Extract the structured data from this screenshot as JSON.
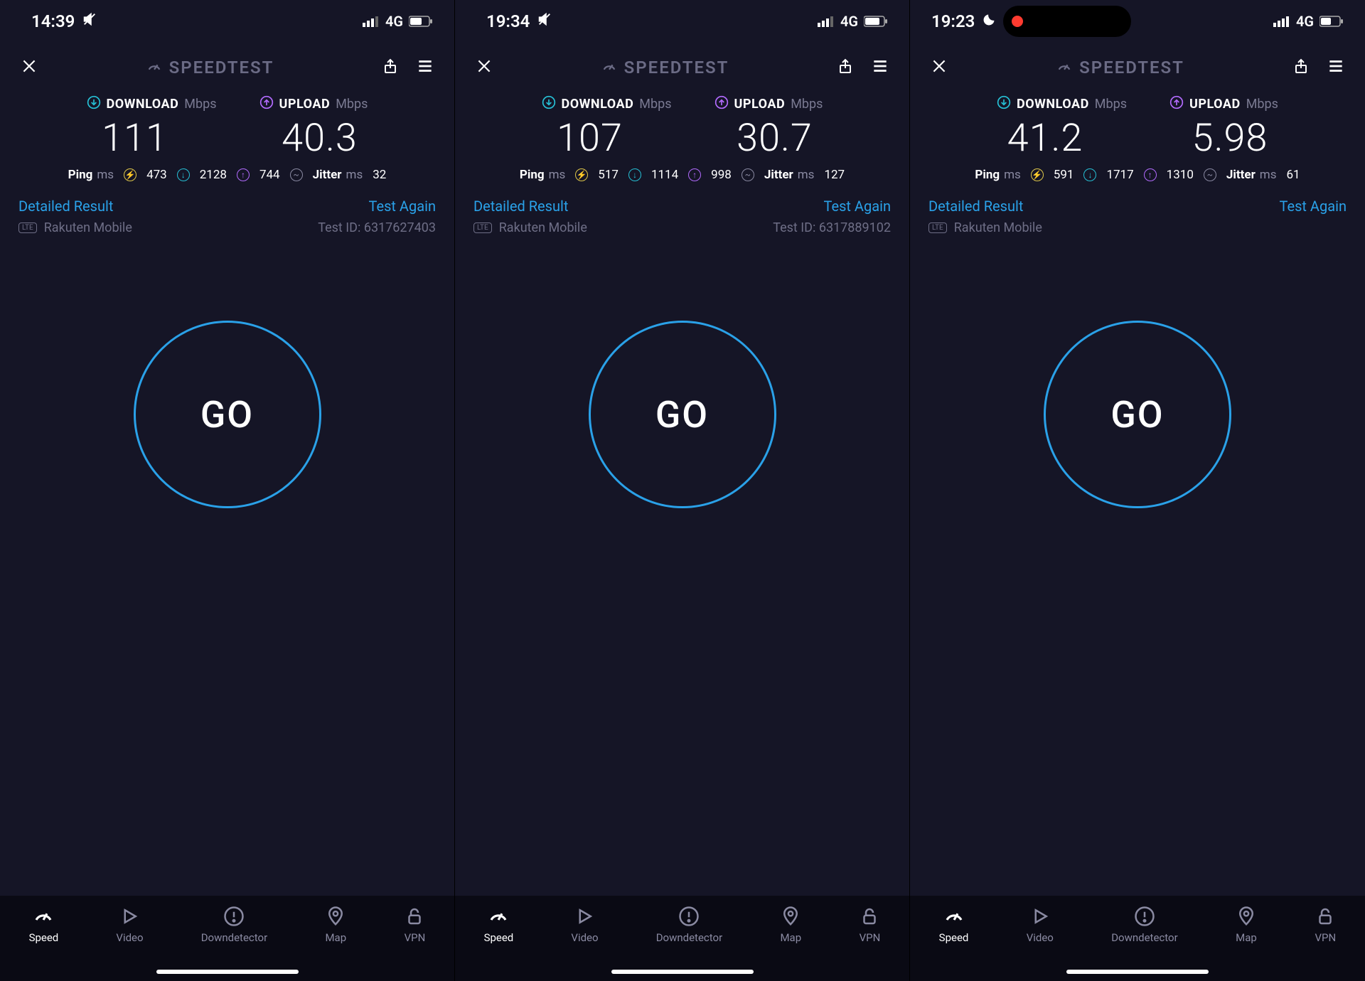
{
  "brand": "SPEEDTEST",
  "labels": {
    "download": "DOWNLOAD",
    "upload": "UPLOAD",
    "mbps": "Mbps",
    "ping": "Ping",
    "ms": "ms",
    "jitter": "Jitter",
    "detailed": "Detailed Result",
    "test_again": "Test Again",
    "test_id_prefix": "Test ID:",
    "go": "GO"
  },
  "nav": [
    "Speed",
    "Video",
    "Downdetector",
    "Map",
    "VPN"
  ],
  "screens": [
    {
      "status": {
        "time": "14:39",
        "network": "4G",
        "moon": false,
        "pill": false,
        "muted": true
      },
      "download": "111",
      "upload": "40.3",
      "ping": {
        "idle": "473",
        "down": "2128",
        "up": "744",
        "jitter": "32"
      },
      "carrier": "Rakuten Mobile",
      "test_id": "6317627403",
      "show_test_id": true
    },
    {
      "status": {
        "time": "19:34",
        "network": "4G",
        "moon": false,
        "pill": false,
        "muted": true
      },
      "download": "107",
      "upload": "30.7",
      "ping": {
        "idle": "517",
        "down": "1114",
        "up": "998",
        "jitter": "127"
      },
      "carrier": "Rakuten Mobile",
      "test_id": "6317889102",
      "show_test_id": true
    },
    {
      "status": {
        "time": "19:23",
        "network": "4G",
        "moon": true,
        "pill": true,
        "muted": false
      },
      "download": "41.2",
      "upload": "5.98",
      "ping": {
        "idle": "591",
        "down": "1717",
        "up": "1310",
        "jitter": "61"
      },
      "carrier": "Rakuten Mobile",
      "test_id": "",
      "show_test_id": false
    }
  ],
  "colors": {
    "bg": "#151526",
    "accent": "#2aa1e8",
    "download": "#26c1d6",
    "upload": "#b36bff",
    "muted": "#6e6e86"
  }
}
